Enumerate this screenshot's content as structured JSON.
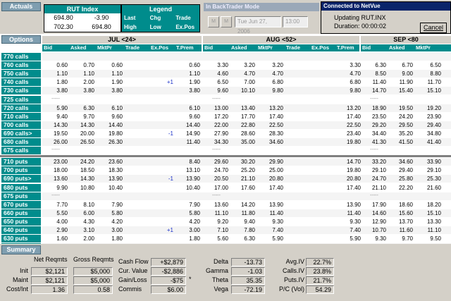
{
  "header": {
    "actuals_label": "Actuals",
    "rut": {
      "title": "RUT Index",
      "rows": [
        [
          "694.80",
          "-3.90"
        ],
        [
          "702.30",
          "694.80"
        ]
      ]
    },
    "legend": {
      "title": "Legend",
      "rows": [
        [
          "Last",
          "Chg",
          "Trade"
        ],
        [
          "High",
          "Low",
          "Ex.Pos"
        ]
      ]
    },
    "backtrader": {
      "title": "In BackTrader Mode",
      "nav1": "M",
      "nav2": "M",
      "date": "Tue Jun 27, 2006",
      "time": "13:00"
    },
    "dialog": {
      "title": "Connected to NetVue",
      "line1": "Updating RUT.INX",
      "line2": "Duration:  00:00:02",
      "cancel_label": "Cancel"
    }
  },
  "options_label": "Options",
  "months": [
    {
      "label": "JUL <24>",
      "cols": [
        "Bid",
        "Asked",
        "MktPr",
        "Trade",
        "Ex.Pos",
        "T.Prem"
      ]
    },
    {
      "label": "AUG <52>",
      "cols": [
        "Bid",
        "Asked",
        "MktPr",
        "Trade",
        "Ex.Pos",
        "T.Prem"
      ]
    },
    {
      "label": "SEP <80",
      "cols": [
        "Bid",
        "Asked",
        "MktPr"
      ]
    }
  ],
  "rows": [
    {
      "label": "770 calls",
      "jul": [
        "",
        "",
        "",
        "",
        "",
        ""
      ],
      "aug": [
        "",
        "",
        "",
        "",
        "",
        ""
      ],
      "sep": [
        "",
        "",
        ""
      ]
    },
    {
      "label": "760 calls",
      "jul": [
        "0.60",
        "0.70",
        "0.60",
        "",
        "",
        "0.60"
      ],
      "aug": [
        "3.30",
        "3.20",
        "3.20",
        "",
        "",
        "3.30"
      ],
      "sep": [
        "6.30",
        "6.70",
        "6.50"
      ]
    },
    {
      "label": "750 calls",
      "jul": [
        "1.10",
        "1.10",
        "1.10",
        "",
        "",
        "1.10"
      ],
      "aug": [
        "4.60",
        "4.70",
        "4.70",
        "",
        "",
        "4.70"
      ],
      "sep": [
        "8.50",
        "9.00",
        "8.80"
      ]
    },
    {
      "label": "740 calls",
      "jul": [
        "1.80",
        "2.00",
        "1.90",
        "",
        "+1",
        "1.90"
      ],
      "aug": [
        "6.50",
        "7.00",
        "6.80",
        "",
        "",
        "6.80"
      ],
      "sep": [
        "11.40",
        "11.90",
        "11.70"
      ]
    },
    {
      "label": "730 calls",
      "jul": [
        "3.80",
        "3.80",
        "3.80",
        "",
        "",
        "3.80"
      ],
      "aug": [
        "9.60",
        "10.10",
        "9.80",
        "",
        "",
        "9.80"
      ],
      "sep": [
        "14.70",
        "15.40",
        "15.10"
      ]
    },
    {
      "label": "725 calls",
      "jul": [
        "-----",
        "",
        "",
        "",
        "",
        ""
      ],
      "aug": [
        "-----",
        "",
        "",
        "",
        "",
        ""
      ],
      "sep": [
        "-----",
        "",
        ""
      ]
    },
    {
      "label": "720 calls",
      "jul": [
        "5.90",
        "6.30",
        "6.10",
        "",
        "",
        "6.10"
      ],
      "aug": [
        "13.00",
        "13.40",
        "13.20",
        "",
        "",
        "13.20"
      ],
      "sep": [
        "18.90",
        "19.50",
        "19.20"
      ]
    },
    {
      "label": "710 calls",
      "jul": [
        "9.40",
        "9.70",
        "9.60",
        "",
        "",
        "9.60"
      ],
      "aug": [
        "17.20",
        "17.70",
        "17.40",
        "",
        "",
        "17.40"
      ],
      "sep": [
        "23.50",
        "24.20",
        "23.90"
      ]
    },
    {
      "label": "700 calls",
      "jul": [
        "14.30",
        "14.30",
        "14.40",
        "",
        "",
        "14.40"
      ],
      "aug": [
        "22.00",
        "22.80",
        "22.50",
        "",
        "",
        "22.50"
      ],
      "sep": [
        "29.20",
        "29.50",
        "29.40"
      ]
    },
    {
      "label": "690 calls>",
      "jul": [
        "19.50",
        "20.00",
        "19.80",
        "",
        "-1",
        "14.90"
      ],
      "aug": [
        "27.90",
        "28.60",
        "28.30",
        "",
        "",
        "23.40"
      ],
      "sep": [
        "34.40",
        "35.20",
        "34.80"
      ]
    },
    {
      "label": "680 calls",
      "jul": [
        "26.00",
        "26.50",
        "26.30",
        "",
        "",
        "11.40"
      ],
      "aug": [
        "34.30",
        "35.00",
        "34.60",
        "",
        "",
        "19.80"
      ],
      "sep": [
        "41.30",
        "41.50",
        "41.40"
      ]
    },
    {
      "label": "675 calls",
      "jul": [
        "-----",
        "",
        "",
        "",
        "",
        ""
      ],
      "aug": [
        "-----",
        "",
        "",
        "",
        "",
        ""
      ],
      "sep": [
        "-----",
        "",
        ""
      ]
    },
    {
      "label": "710 puts",
      "jul": [
        "23.00",
        "24.20",
        "23.60",
        "",
        "",
        "8.40"
      ],
      "aug": [
        "29.60",
        "30.20",
        "29.90",
        "",
        "",
        "14.70"
      ],
      "sep": [
        "33.20",
        "34.60",
        "33.90"
      ]
    },
    {
      "label": "700 puts",
      "jul": [
        "18.00",
        "18.50",
        "18.30",
        "",
        "",
        "13.10"
      ],
      "aug": [
        "24.70",
        "25.20",
        "25.00",
        "",
        "",
        "19.80"
      ],
      "sep": [
        "29.10",
        "29.40",
        "29.10"
      ]
    },
    {
      "label": "690 puts>",
      "jul": [
        "13.60",
        "14.30",
        "13.90",
        "",
        "-1",
        "13.90"
      ],
      "aug": [
        "20.50",
        "21.10",
        "20.80",
        "",
        "",
        "20.80"
      ],
      "sep": [
        "24.70",
        "25.80",
        "25.30"
      ]
    },
    {
      "label": "680 puts",
      "jul": [
        "9.90",
        "10.80",
        "10.40",
        "",
        "",
        "10.40"
      ],
      "aug": [
        "17.00",
        "17.60",
        "17.40",
        "",
        "",
        "17.40"
      ],
      "sep": [
        "21.10",
        "22.20",
        "21.60"
      ]
    },
    {
      "label": "675 puts",
      "jul": [
        "-----",
        "",
        "",
        "",
        "",
        ""
      ],
      "aug": [
        "-----",
        "",
        "",
        "",
        "",
        ""
      ],
      "sep": [
        "-----",
        "",
        ""
      ]
    },
    {
      "label": "670 puts",
      "jul": [
        "7.70",
        "8.10",
        "7.90",
        "",
        "",
        "7.90"
      ],
      "aug": [
        "13.60",
        "14.20",
        "13.90",
        "",
        "",
        "13.90"
      ],
      "sep": [
        "17.90",
        "18.60",
        "18.20"
      ]
    },
    {
      "label": "660 puts",
      "jul": [
        "5.50",
        "6.00",
        "5.80",
        "",
        "",
        "5.80"
      ],
      "aug": [
        "11.10",
        "11.80",
        "11.40",
        "",
        "",
        "11.40"
      ],
      "sep": [
        "14.60",
        "15.60",
        "15.10"
      ]
    },
    {
      "label": "650 puts",
      "jul": [
        "4.00",
        "4.30",
        "4.20",
        "",
        "",
        "4.20"
      ],
      "aug": [
        "9.20",
        "9.40",
        "9.30",
        "",
        "",
        "9.30"
      ],
      "sep": [
        "12.90",
        "13.70",
        "13.30"
      ]
    },
    {
      "label": "640 puts",
      "jul": [
        "2.90",
        "3.10",
        "3.00",
        "",
        "+1",
        "3.00"
      ],
      "aug": [
        "7.10",
        "7.80",
        "7.40",
        "",
        "",
        "7.40"
      ],
      "sep": [
        "10.70",
        "11.60",
        "11.10"
      ]
    },
    {
      "label": "630 puts",
      "jul": [
        "1.60",
        "2.00",
        "1.80",
        "",
        "",
        "1.80"
      ],
      "aug": [
        "5.60",
        "6.30",
        "5.90",
        "",
        "",
        "5.90"
      ],
      "sep": [
        "9.30",
        "9.70",
        "9.50"
      ]
    },
    {
      "label": "620 puts",
      "jul": [
        "1.10",
        "1.50",
        "1.30",
        "",
        "",
        "1.30"
      ],
      "aug": [
        "4.20",
        "4.70",
        "4.50",
        "",
        "",
        "4.50"
      ],
      "sep": [
        "7.30",
        "8.00",
        "7.70"
      ]
    }
  ],
  "summary": {
    "label": "Summary",
    "h1": "Net Reqmts",
    "h2": "Gross Reqmts",
    "rows": [
      {
        "k": "Init",
        "a": "$2,121",
        "b": "$5,000"
      },
      {
        "k": "Maint",
        "a": "$2,121",
        "b": "$5,000"
      },
      {
        "k": "Cost/Int",
        "a": "1.36",
        "b": "0.58"
      }
    ],
    "cash": [
      {
        "k": "Cash Flow",
        "v": "+$2,879"
      },
      {
        "k": "Cur. Value",
        "v": "-$2,886"
      },
      {
        "k": "Gain/Loss",
        "v": "-$75"
      },
      {
        "k": "Commis",
        "v": "$6.00"
      }
    ],
    "greeks": [
      {
        "k": "Delta",
        "v": "-13.73"
      },
      {
        "k": "Gamma",
        "v": "-1.03"
      },
      {
        "k": "Theta",
        "v": "35.35"
      },
      {
        "k": "Vega",
        "v": "-72.19"
      }
    ],
    "iv": [
      {
        "k": "Avg.IV",
        "v": "22.7%"
      },
      {
        "k": "Calls.IV",
        "v": "23.8%"
      },
      {
        "k": "Puts.IV",
        "v": "21.7%"
      },
      {
        "k": "P/C (Vol)",
        "v": "54.29"
      }
    ],
    "star": "*"
  }
}
